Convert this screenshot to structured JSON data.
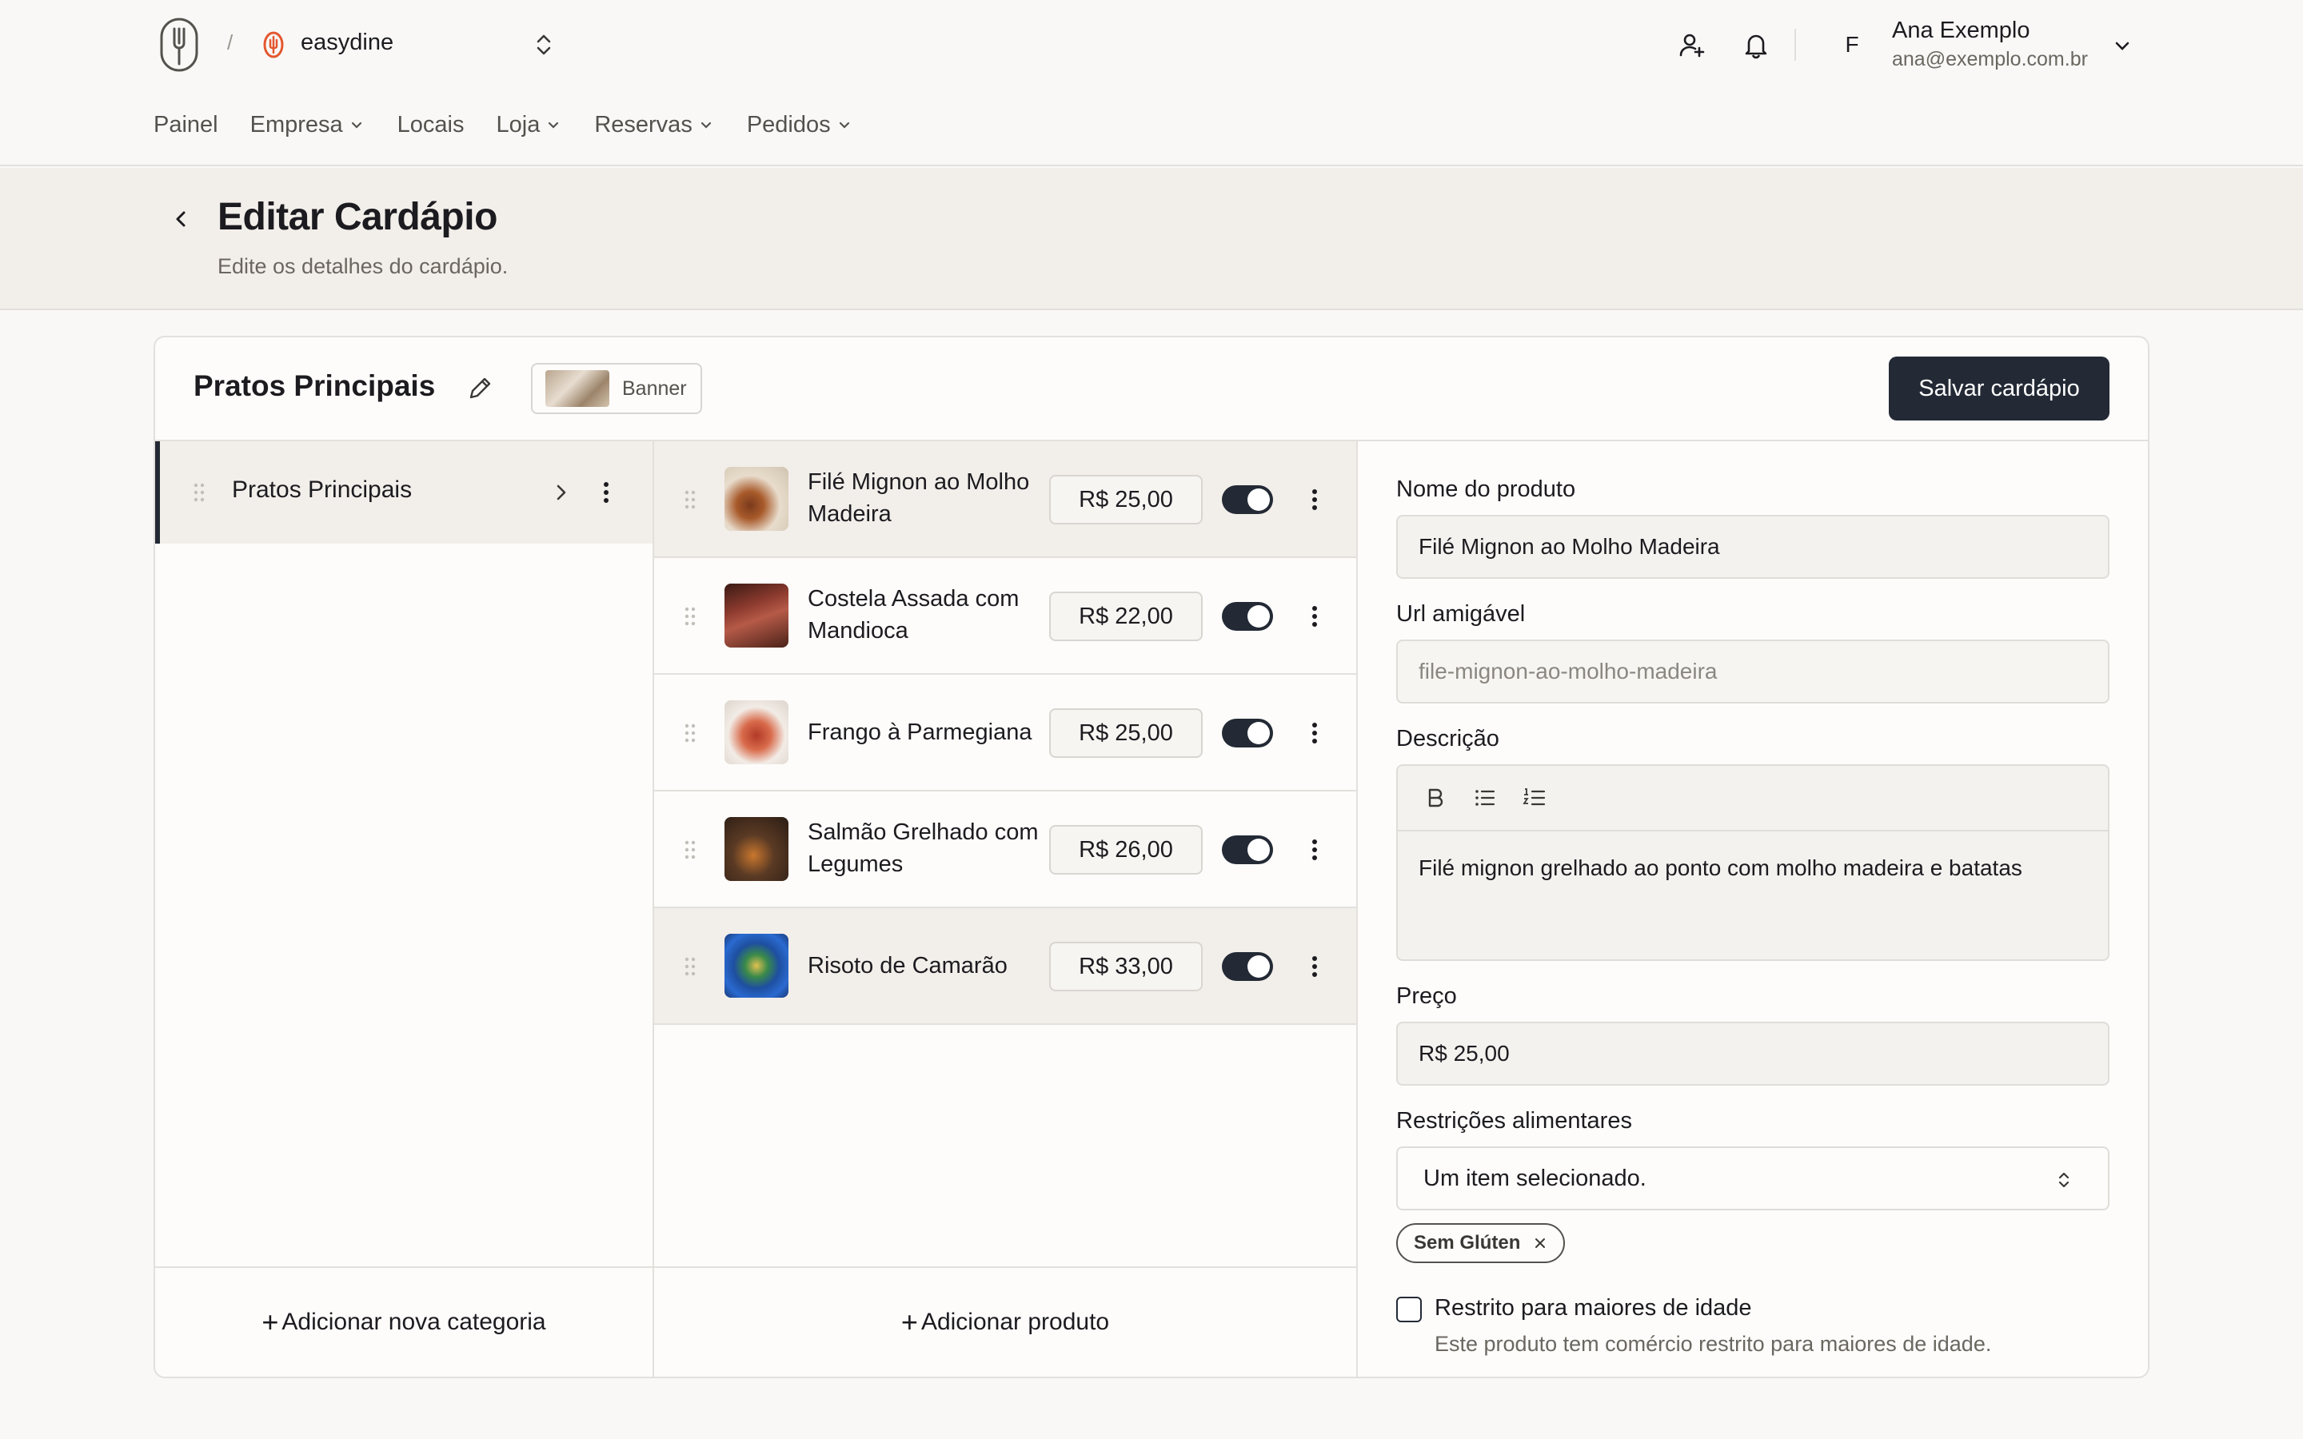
{
  "topbar": {
    "separator": "/",
    "brand": "easydine",
    "nav": [
      {
        "label": "Painel",
        "has_dropdown": false
      },
      {
        "label": "Empresa",
        "has_dropdown": true
      },
      {
        "label": "Locais",
        "has_dropdown": false
      },
      {
        "label": "Loja",
        "has_dropdown": true
      },
      {
        "label": "Reservas",
        "has_dropdown": true
      },
      {
        "label": "Pedidos",
        "has_dropdown": true
      }
    ],
    "user": {
      "initial": "F",
      "name": "Ana Exemplo",
      "email": "ana@exemplo.com.br"
    }
  },
  "header": {
    "title": "Editar Cardápio",
    "subtitle": "Edite os detalhes do cardápio."
  },
  "card": {
    "title": "Pratos Principais",
    "banner_label": "Banner",
    "save_label": "Salvar cardápio"
  },
  "categories": {
    "items": [
      {
        "label": "Pratos Principais",
        "active": true
      }
    ],
    "add_label": "Adicionar nova categoria"
  },
  "products": {
    "items": [
      {
        "name": "Filé Mignon ao Molho Madeira",
        "price": "R$ 25,00",
        "enabled": true,
        "selected": true
      },
      {
        "name": "Costela Assada com Mandioca",
        "price": "R$ 22,00",
        "enabled": true,
        "selected": false
      },
      {
        "name": "Frango à Parmegiana",
        "price": "R$ 25,00",
        "enabled": true,
        "selected": false
      },
      {
        "name": "Salmão Grelhado com Legumes",
        "price": "R$ 26,00",
        "enabled": true,
        "selected": false
      },
      {
        "name": "Risoto de Camarão",
        "price": "R$ 33,00",
        "enabled": true,
        "selected": false
      }
    ],
    "add_label": "Adicionar produto"
  },
  "form": {
    "name_label": "Nome do produto",
    "name_value": "Filé Mignon ao Molho Madeira",
    "url_label": "Url amigável",
    "url_value": "file-mignon-ao-molho-madeira",
    "description_label": "Descrição",
    "description_value": "Filé mignon grelhado ao ponto com molho madeira e batatas",
    "price_label": "Preço",
    "price_value": "R$ 25,00",
    "restrictions_label": "Restrições alimentares",
    "restrictions_value": "Um item selecionado.",
    "restriction_chips": [
      "Sem Glúten"
    ],
    "adult_label": "Restrito para maiores de idade",
    "adult_help": "Este produto tem comércio restrito para maiores de idade.",
    "adult_checked": false
  },
  "colors": {
    "primary": "#232a35",
    "brand_accent": "#e4572e",
    "header_band": "#f2eeea",
    "background": "#f9f8f7"
  },
  "icons": [
    "fork-logo-icon",
    "brand-flame-icon",
    "chevron-up-down-icon",
    "chevron-down-icon",
    "user-add-icon",
    "bell-icon",
    "chevron-left-icon",
    "pencil-icon",
    "drag-handle-icon",
    "chevron-right-icon",
    "kebab-menu-icon",
    "plus-icon",
    "bold-icon",
    "bullet-list-icon",
    "numbered-list-icon",
    "close-icon"
  ]
}
